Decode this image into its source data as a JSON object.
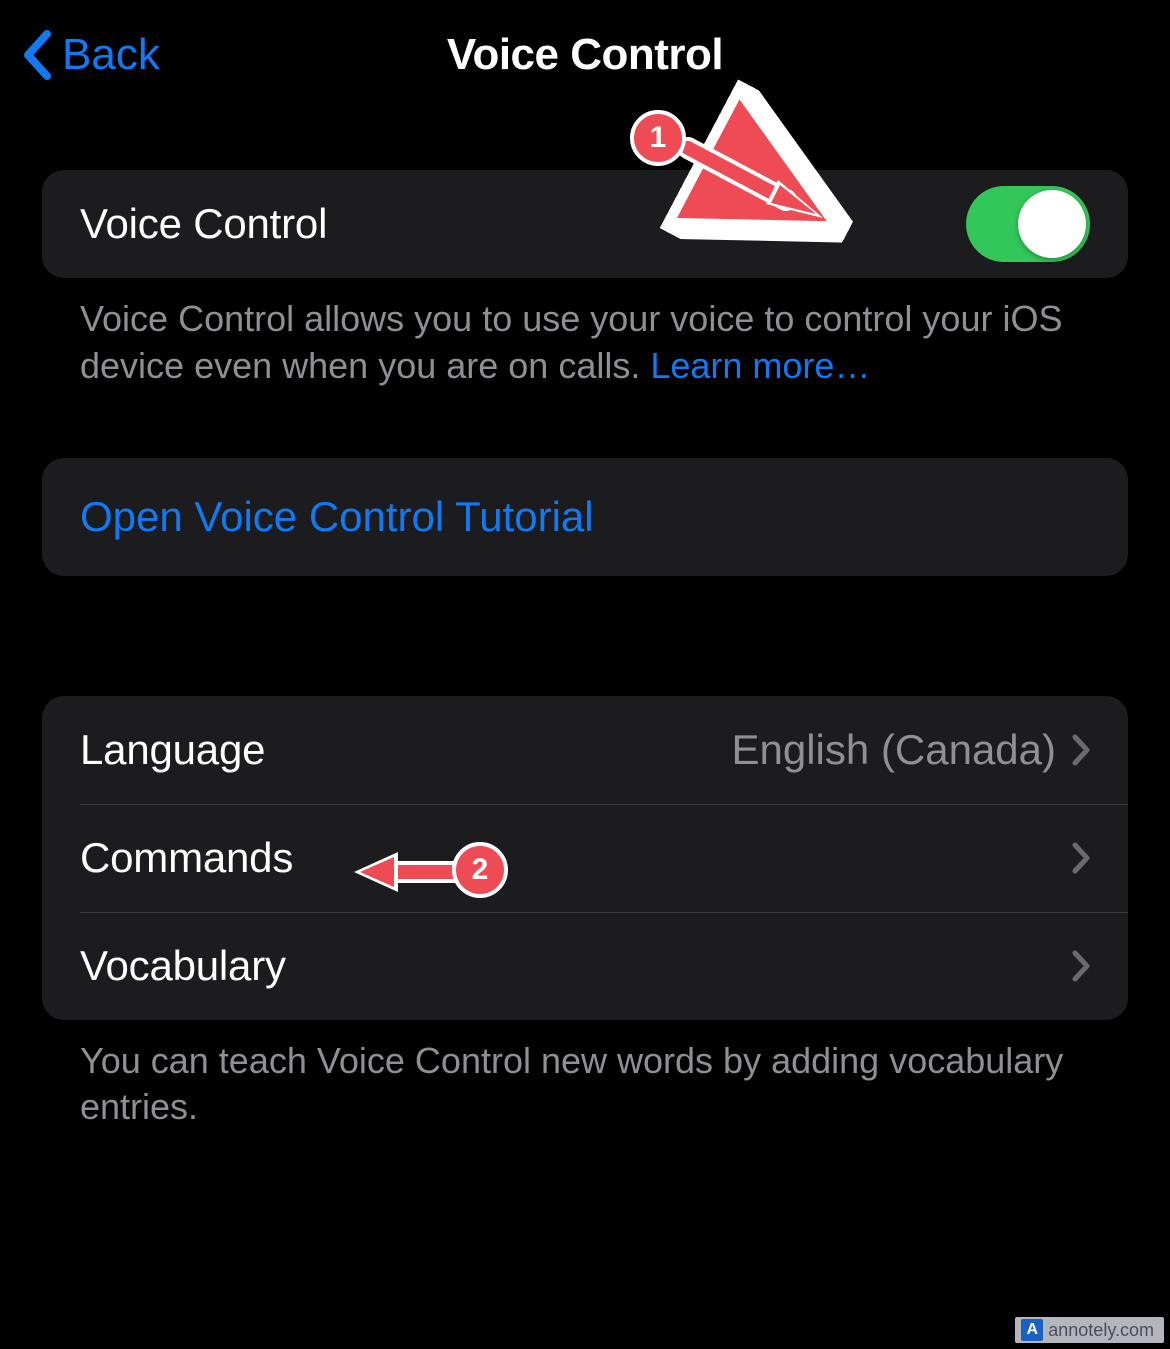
{
  "header": {
    "back_label": "Back",
    "title": "Voice Control"
  },
  "main_toggle": {
    "label": "Voice Control",
    "enabled": true,
    "description": "Voice Control allows you to use your voice to control your iOS device even when you are on calls. ",
    "learn_more": "Learn more…"
  },
  "tutorial": {
    "label": "Open Voice Control Tutorial"
  },
  "settings": {
    "rows": [
      {
        "label": "Language",
        "value": "English (Canada)"
      },
      {
        "label": "Commands",
        "value": ""
      },
      {
        "label": "Vocabulary",
        "value": ""
      }
    ],
    "footer": "You can teach Voice Control new words by adding vocabulary entries."
  },
  "annotations": {
    "badge1": "1",
    "badge2": "2"
  },
  "watermark": "annotely.com",
  "colors": {
    "accent_blue": "#1079f3",
    "toggle_green": "#33c759",
    "cell_bg": "#1c1c1e",
    "secondary_text": "#8f8f94",
    "annotation_red": "#ef4b55"
  }
}
